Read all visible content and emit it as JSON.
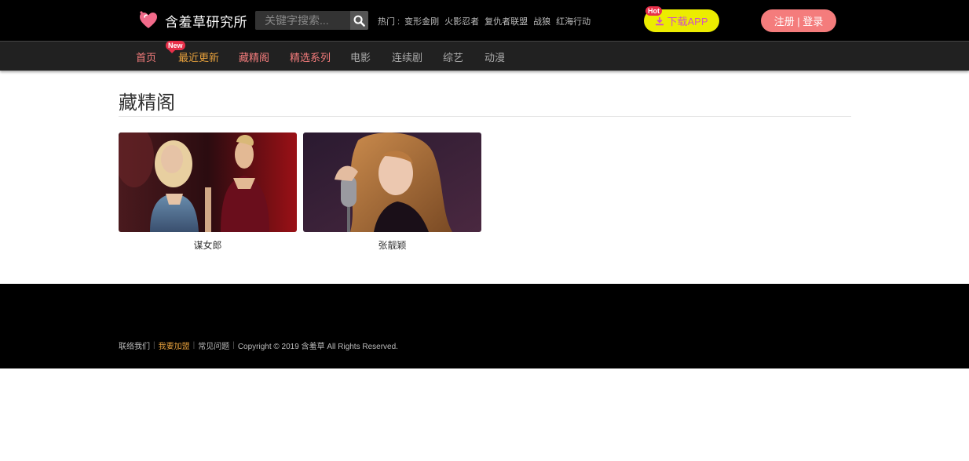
{
  "header": {
    "site_name": "含羞草研究所",
    "search": {
      "placeholder": "关键字搜索..."
    },
    "hot": {
      "label": "热门 :",
      "keywords": [
        "变形金刚",
        "火影忍者",
        "复仇者联盟",
        "战狼",
        "红海行动"
      ]
    },
    "app_button": {
      "badge": "Hot",
      "label": "下载APP"
    },
    "auth_button": "注册 | 登录"
  },
  "nav": {
    "new_badge": "New",
    "items": [
      {
        "label": "首页",
        "color": "#f47c7c"
      },
      {
        "label": "最近更新",
        "color": "#e6a03c"
      },
      {
        "label": "藏精阁",
        "color": "#f47c7c"
      },
      {
        "label": "精选系列",
        "color": "#f47c7c"
      },
      {
        "label": "电影",
        "color": "#aaaaaa"
      },
      {
        "label": "连续剧",
        "color": "#aaaaaa"
      },
      {
        "label": "综艺",
        "color": "#aaaaaa"
      },
      {
        "label": "动漫",
        "color": "#aaaaaa"
      }
    ]
  },
  "main": {
    "title": "藏精阁",
    "cards": [
      {
        "label": "谋女郎"
      },
      {
        "label": "张靓颖"
      }
    ]
  },
  "footer": {
    "links": [
      "联络我们",
      "我要加盟",
      "常见问题"
    ],
    "copyright": "Copyright © 2019 含羞草 All Rights Reserved."
  },
  "colors": {
    "brand_pink": "#f47c7c",
    "accent_gold": "#e6a03c",
    "app_yellow": "#ecec00",
    "badge_red": "#e8304a"
  }
}
